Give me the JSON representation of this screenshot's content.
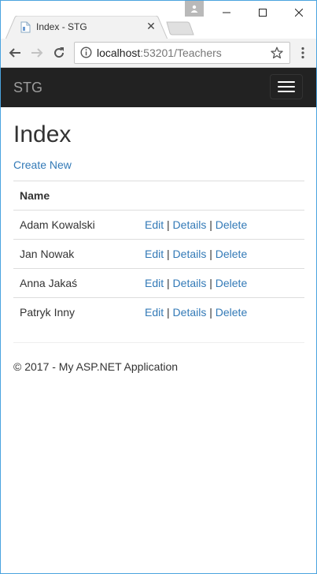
{
  "browser": {
    "tab_title": "Index - STG",
    "url_host": "localhost",
    "url_rest": ":53201/Teachers"
  },
  "navbar": {
    "brand": "STG"
  },
  "page": {
    "heading": "Index",
    "create_link": "Create New",
    "table": {
      "header": "Name",
      "rows": [
        {
          "name": "Adam Kowalski"
        },
        {
          "name": "Jan Nowak"
        },
        {
          "name": "Anna Jakaś"
        },
        {
          "name": "Patryk Inny"
        }
      ],
      "actions": {
        "edit": "Edit",
        "details": "Details",
        "delete": "Delete",
        "sep": "|"
      }
    },
    "footer": "© 2017 - My ASP.NET Application"
  },
  "colors": {
    "navbar_bg": "#222222",
    "link": "#337ab7",
    "window_border": "#4aa3df"
  }
}
